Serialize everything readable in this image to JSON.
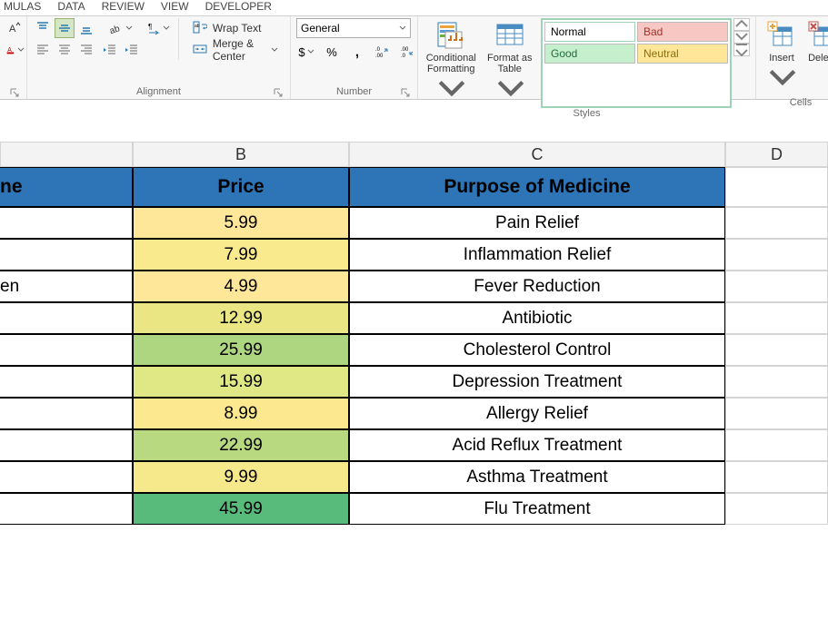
{
  "tabs": {
    "mulas": "MULAS",
    "data": "DATA",
    "review": "REVIEW",
    "view": "VIEW",
    "developer": "DEVELOPER"
  },
  "ribbon": {
    "wrap_text": "Wrap Text",
    "merge_center": "Merge & Center",
    "alignment_label": "Alignment",
    "number_format": "General",
    "dollar": "$",
    "percent": "%",
    "comma": ",",
    "inc_dec": "",
    "dec_dec": "",
    "number_label": "Number",
    "cond_fmt_line1": "Conditional",
    "cond_fmt_line2": "Formatting",
    "fmt_table_line1": "Format as",
    "fmt_table_line2": "Table",
    "style_normal": "Normal",
    "style_bad": "Bad",
    "style_good": "Good",
    "style_neutral": "Neutral",
    "styles_label": "Styles",
    "insert": "Insert",
    "delete": "Delete",
    "cells_label": "Cells"
  },
  "columns": {
    "A": "",
    "B": "B",
    "C": "C",
    "D": "D"
  },
  "sheet": {
    "head_a": "ne",
    "head_b": "Price",
    "head_c": "Purpose of Medicine",
    "rows": [
      {
        "a": "",
        "b": "5.99",
        "c": "Pain Relief",
        "b_bg": "#ffe799"
      },
      {
        "a": "",
        "b": "7.99",
        "c": "Inflammation Relief",
        "b_bg": "#faea8e"
      },
      {
        "a": "en",
        "b": "4.99",
        "c": "Fever Reduction",
        "b_bg": "#ffe799"
      },
      {
        "a": "",
        "b": "12.99",
        "c": "Antibiotic",
        "b_bg": "#e9e683"
      },
      {
        "a": "",
        "b": "25.99",
        "c": "Cholesterol Control",
        "b_bg": "#aed57f"
      },
      {
        "a": "",
        "b": "15.99",
        "c": "Depression Treatment",
        "b_bg": "#dfe884"
      },
      {
        "a": "",
        "b": "8.99",
        "c": "Allergy Relief",
        "b_bg": "#fbe88f"
      },
      {
        "a": "",
        "b": "22.99",
        "c": "Acid Reflux Treatment",
        "b_bg": "#b9d980"
      },
      {
        "a": "",
        "b": "9.99",
        "c": "Asthma Treatment",
        "b_bg": "#f6e98b"
      },
      {
        "a": "",
        "b": "45.99",
        "c": "Flu Treatment",
        "b_bg": "#58bb7c"
      }
    ]
  }
}
